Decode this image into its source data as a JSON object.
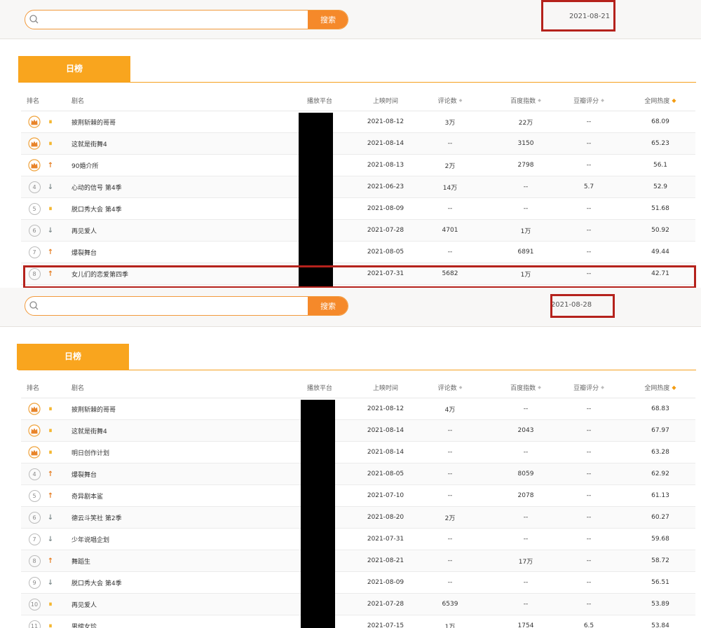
{
  "common": {
    "search_placeholder": "",
    "search_button": "搜索",
    "tab_daily": "日榜",
    "headers": {
      "rank": "排名",
      "name": "剧名",
      "platform": "播放平台",
      "release": "上映时间",
      "comments": "评论数",
      "baidu": "百度指数",
      "douban": "豆瓣评分",
      "heat": "全网热度"
    },
    "sort_icon": "◆"
  },
  "colors": {
    "accent": "#f9a51e",
    "search_button": "#f5892a",
    "highlight_border": "#b5221c",
    "trend_up": "#e67e22",
    "trend_down": "#7f8c8d",
    "trend_same": "#f4b223"
  },
  "panel1": {
    "date": "2021-08-21",
    "rows": [
      {
        "rank": "1",
        "crown": true,
        "trend": "same",
        "trend_symbol": "⏸",
        "name": "披荆斩棘的哥哥",
        "release": "2021-08-12",
        "comments": "3万",
        "baidu": "22万",
        "douban": "--",
        "heat": "68.09"
      },
      {
        "rank": "2",
        "crown": true,
        "trend": "same",
        "trend_symbol": "⏸",
        "name": "这就是街舞4",
        "release": "2021-08-14",
        "comments": "--",
        "baidu": "3150",
        "douban": "--",
        "heat": "65.23"
      },
      {
        "rank": "3",
        "crown": true,
        "trend": "up",
        "trend_symbol": "↑",
        "name": "90婚介所",
        "release": "2021-08-13",
        "comments": "2万",
        "baidu": "2798",
        "douban": "--",
        "heat": "56.1"
      },
      {
        "rank": "4",
        "crown": false,
        "trend": "down",
        "trend_symbol": "↓",
        "name": "心动的信号 第4季",
        "release": "2021-06-23",
        "comments": "14万",
        "baidu": "--",
        "douban": "5.7",
        "heat": "52.9"
      },
      {
        "rank": "5",
        "crown": false,
        "trend": "same",
        "trend_symbol": "⏸",
        "name": "脱口秀大会 第4季",
        "release": "2021-08-09",
        "comments": "--",
        "baidu": "--",
        "douban": "--",
        "heat": "51.68"
      },
      {
        "rank": "6",
        "crown": false,
        "trend": "down",
        "trend_symbol": "↓",
        "name": "再见爱人",
        "release": "2021-07-28",
        "comments": "4701",
        "baidu": "1万",
        "douban": "--",
        "heat": "50.92"
      },
      {
        "rank": "7",
        "crown": false,
        "trend": "up",
        "trend_symbol": "↑",
        "name": "爆裂舞台",
        "release": "2021-08-05",
        "comments": "--",
        "baidu": "6891",
        "douban": "--",
        "heat": "49.44"
      },
      {
        "rank": "8",
        "crown": false,
        "trend": "up",
        "trend_symbol": "↑",
        "name": "女儿们的恋爱第四季",
        "release": "2021-07-31",
        "comments": "5682",
        "baidu": "1万",
        "douban": "--",
        "heat": "42.71"
      }
    ]
  },
  "panel2": {
    "date": "2021-08-28",
    "rows": [
      {
        "rank": "1",
        "crown": true,
        "trend": "same",
        "trend_symbol": "⏸",
        "name": "披荆斩棘的哥哥",
        "release": "2021-08-12",
        "comments": "4万",
        "baidu": "--",
        "douban": "--",
        "heat": "68.83"
      },
      {
        "rank": "2",
        "crown": true,
        "trend": "same",
        "trend_symbol": "⏸",
        "name": "这就是街舞4",
        "release": "2021-08-14",
        "comments": "--",
        "baidu": "2043",
        "douban": "--",
        "heat": "67.97"
      },
      {
        "rank": "3",
        "crown": true,
        "trend": "same",
        "trend_symbol": "⏸",
        "name": "明日创作计划",
        "release": "2021-08-14",
        "comments": "--",
        "baidu": "--",
        "douban": "--",
        "heat": "63.28"
      },
      {
        "rank": "4",
        "crown": false,
        "trend": "up",
        "trend_symbol": "↑",
        "name": "爆裂舞台",
        "release": "2021-08-05",
        "comments": "--",
        "baidu": "8059",
        "douban": "--",
        "heat": "62.92"
      },
      {
        "rank": "5",
        "crown": false,
        "trend": "up",
        "trend_symbol": "↑",
        "name": "奇异剧本鲨",
        "release": "2021-07-10",
        "comments": "--",
        "baidu": "2078",
        "douban": "--",
        "heat": "61.13"
      },
      {
        "rank": "6",
        "crown": false,
        "trend": "down",
        "trend_symbol": "↓",
        "name": "德云斗笑社 第2季",
        "release": "2021-08-20",
        "comments": "2万",
        "baidu": "--",
        "douban": "--",
        "heat": "60.27"
      },
      {
        "rank": "7",
        "crown": false,
        "trend": "down",
        "trend_symbol": "↓",
        "name": "少年说唱企划",
        "release": "2021-07-31",
        "comments": "--",
        "baidu": "--",
        "douban": "--",
        "heat": "59.68"
      },
      {
        "rank": "8",
        "crown": false,
        "trend": "up",
        "trend_symbol": "↑",
        "name": "舞蹈生",
        "release": "2021-08-21",
        "comments": "--",
        "baidu": "17万",
        "douban": "--",
        "heat": "58.72"
      },
      {
        "rank": "9",
        "crown": false,
        "trend": "down",
        "trend_symbol": "↓",
        "name": "脱口秀大会 第4季",
        "release": "2021-08-09",
        "comments": "--",
        "baidu": "--",
        "douban": "--",
        "heat": "56.51"
      },
      {
        "rank": "10",
        "crown": false,
        "trend": "same",
        "trend_symbol": "⏸",
        "name": "再见爱人",
        "release": "2021-07-28",
        "comments": "6539",
        "baidu": "--",
        "douban": "--",
        "heat": "53.89"
      },
      {
        "rank": "11",
        "crown": false,
        "trend": "same",
        "trend_symbol": "⏸",
        "name": "男绾女珍",
        "release": "2021-07-15",
        "comments": "1万",
        "baidu": "1754",
        "douban": "6.5",
        "heat": "53.84"
      }
    ]
  }
}
